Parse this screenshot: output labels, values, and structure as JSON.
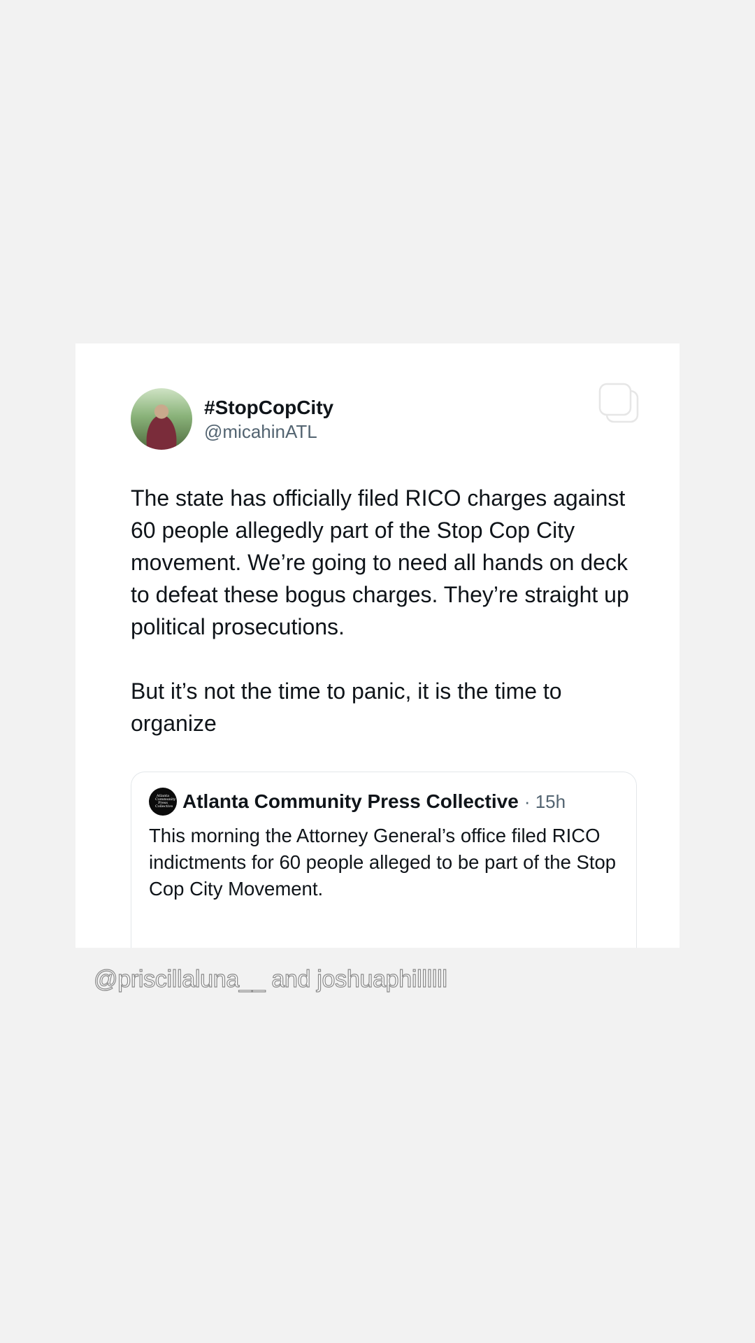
{
  "tweet": {
    "display_name": "#StopCopCity",
    "handle": "@micahinATL",
    "paragraphs": [
      "The state has officially filed RICO charges against 60 people allegedly part of the Stop Cop City movement. We’re going to need all hands on deck to defeat these bogus charges. They’re straight up political prosecutions.",
      "But it’s not the time to panic, it is the time to organize"
    ],
    "icons": {
      "avatar": "profile-photo",
      "copy": "copy-icon"
    }
  },
  "quote": {
    "name": "Atlanta Community Press Collective",
    "meta": "· 15h",
    "text": "This morning the Attorney General’s office filed RICO indictments for 60 people alleged to be part of the Stop Cop City Movement.",
    "logo_text": "Atlanta Community Press Collective"
  },
  "story": {
    "mention_text": "@priscillaluna__ and joshuaphillllll"
  },
  "colors": {
    "background": "#f2f2f2",
    "card": "#ffffff",
    "text_primary": "#0f1419",
    "text_secondary": "#536471"
  }
}
